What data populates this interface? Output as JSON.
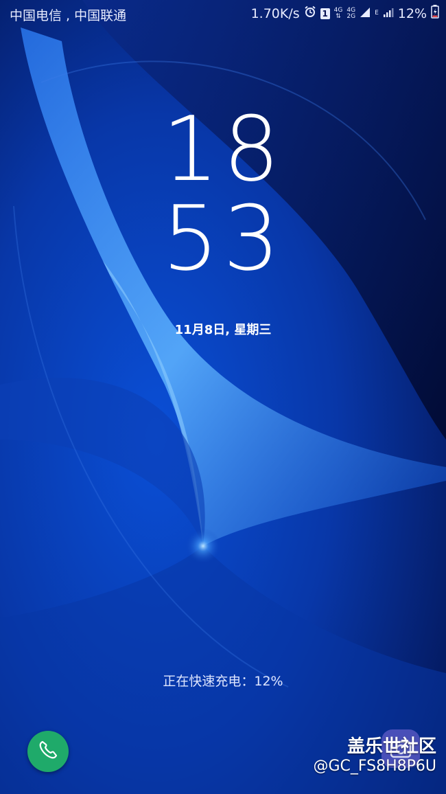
{
  "status_bar": {
    "carriers": "中国电信 , 中国联通",
    "net_speed": "1.70K/s",
    "sim_slot": "1",
    "net_type_1": "4G",
    "net_type_2a": "4G",
    "net_type_2b": "2G",
    "edge_label": "E",
    "battery_percent": "12%"
  },
  "lock_screen": {
    "hour": "18",
    "minute": "53",
    "date": "11月8日, 星期三",
    "charging_status": "正在快速充电：12%"
  },
  "watermark": {
    "site": "盖乐世社区",
    "user": "@GC_FS8H8P6U"
  },
  "colors": {
    "background_dark": "#020a3a",
    "wallpaper_blue": "#0a3fb8",
    "phone_shortcut": "#1faa6a",
    "camera_shortcut": "#826edc"
  },
  "icons": {
    "alarm": "alarm-clock-icon",
    "signal": "signal-bars-icon",
    "battery": "battery-charging-icon",
    "phone": "phone-handset-icon",
    "camera": "camera-icon"
  }
}
